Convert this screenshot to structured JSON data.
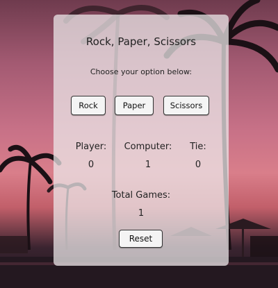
{
  "game": {
    "title": "Rock, Paper, Scissors",
    "subtitle": "Choose your option below:",
    "options": [
      "Rock",
      "Paper",
      "Scissors"
    ]
  },
  "scoreboard": {
    "player_label": "Player:",
    "computer_label": "Computer:",
    "tie_label": "Tie:",
    "player_score": "0",
    "computer_score": "1",
    "tie_score": "0",
    "total_label": "Total Games:",
    "total_games": "1"
  },
  "reset_label": "Reset"
}
